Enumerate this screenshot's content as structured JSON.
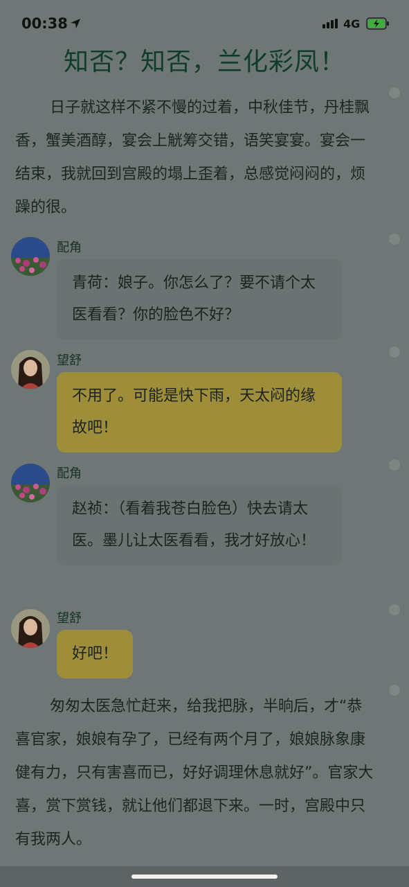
{
  "status": {
    "time": "00:38",
    "network": "4G",
    "icons": [
      "location-arrow-icon",
      "signal-icon",
      "battery-charging-icon"
    ]
  },
  "story": {
    "title": "知否？知否，兰化彩凤！",
    "paragraph1": "日子就这样不紧不慢的过着，中秋佳节，丹桂飘香，蟹美酒醇，宴会上觥筹交错，语笑宴宴。宴会一结束，我就回到宫殿的塌上歪着，总感觉闷闷的，烦躁的很。",
    "messages": [
      {
        "speaker": "配角",
        "text": "青荷：娘子。你怎么了？要不请个太医看看？你的脸色不好？"
      },
      {
        "speaker": "望舒",
        "text": "不用了。可能是快下雨，天太闷的缘故吧！"
      },
      {
        "speaker": "配角",
        "text": "赵祯：（看着我苍白脸色）快去请太医。墨儿让太医看看，我才好放心！"
      },
      {
        "speaker": "望舒",
        "text": "好吧！"
      }
    ],
    "paragraph2": "匆匆太医急忙赶来，给我把脉，半晌后，才“恭喜官家，娘娘有孕了，已经有两个月了，娘娘脉象康健有力，只有害喜而已，好好调理休息就好”。官家大喜，赏下赏钱，就让他们都退下来。一时，宫殿中只有我两人。"
  },
  "colors": {
    "overlay_bg": "#6e7775",
    "title_color": "#103c2e",
    "gray_bubble": "#6b7272",
    "gold_bubble": "#9e8e3a"
  }
}
